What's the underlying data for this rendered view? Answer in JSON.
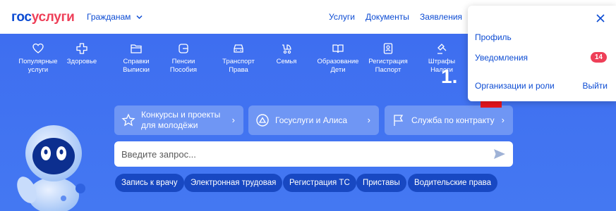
{
  "header": {
    "logo_part1": "гос",
    "logo_part2": "услуги",
    "citizens_label": "Гражданам",
    "nav": [
      "Услуги",
      "Документы",
      "Заявления"
    ]
  },
  "categories": [
    {
      "label": "Популярные услуги",
      "icon": "heart-icon"
    },
    {
      "label": "Здоровье",
      "icon": "medical-cross-icon"
    },
    {
      "label": "Справки Выписки",
      "icon": "folder-icon"
    },
    {
      "label": "Пенсии Пособия",
      "icon": "wallet-icon"
    },
    {
      "label": "Транспорт Права",
      "icon": "car-icon"
    },
    {
      "label": "Семья",
      "icon": "stroller-icon"
    },
    {
      "label": "Образование Дети",
      "icon": "book-icon"
    },
    {
      "label": "Регистрация Паспорт",
      "icon": "id-card-icon"
    },
    {
      "label": "Штрафы Налоги",
      "icon": "gavel-icon"
    }
  ],
  "promos": [
    {
      "line1": "Конкурсы и проекты",
      "line2": "для молодёжи",
      "icon": "star-icon"
    },
    {
      "line1": "Госуслуги и Алиса",
      "icon": "alice-icon"
    },
    {
      "line1": "Служба по контракту",
      "icon": "flag-icon"
    }
  ],
  "search": {
    "placeholder": "Введите запрос..."
  },
  "chips": [
    "Запись к врачу",
    "Электронная трудовая",
    "Регистрация ТС",
    "Приставы",
    "Водительские права"
  ],
  "dropdown": {
    "profile": "Профиль",
    "notifications": "Уведомления",
    "notifications_count": "14",
    "orgs": "Организации и роли",
    "logout": "Выйти"
  },
  "annotation": {
    "step": "1."
  },
  "colors": {
    "brand_blue": "#0d4cd3",
    "brand_red": "#ee3f58",
    "hero_blue": "#3f6ff0",
    "chip_blue": "#1848c2",
    "arrow_red": "#e8141c"
  }
}
